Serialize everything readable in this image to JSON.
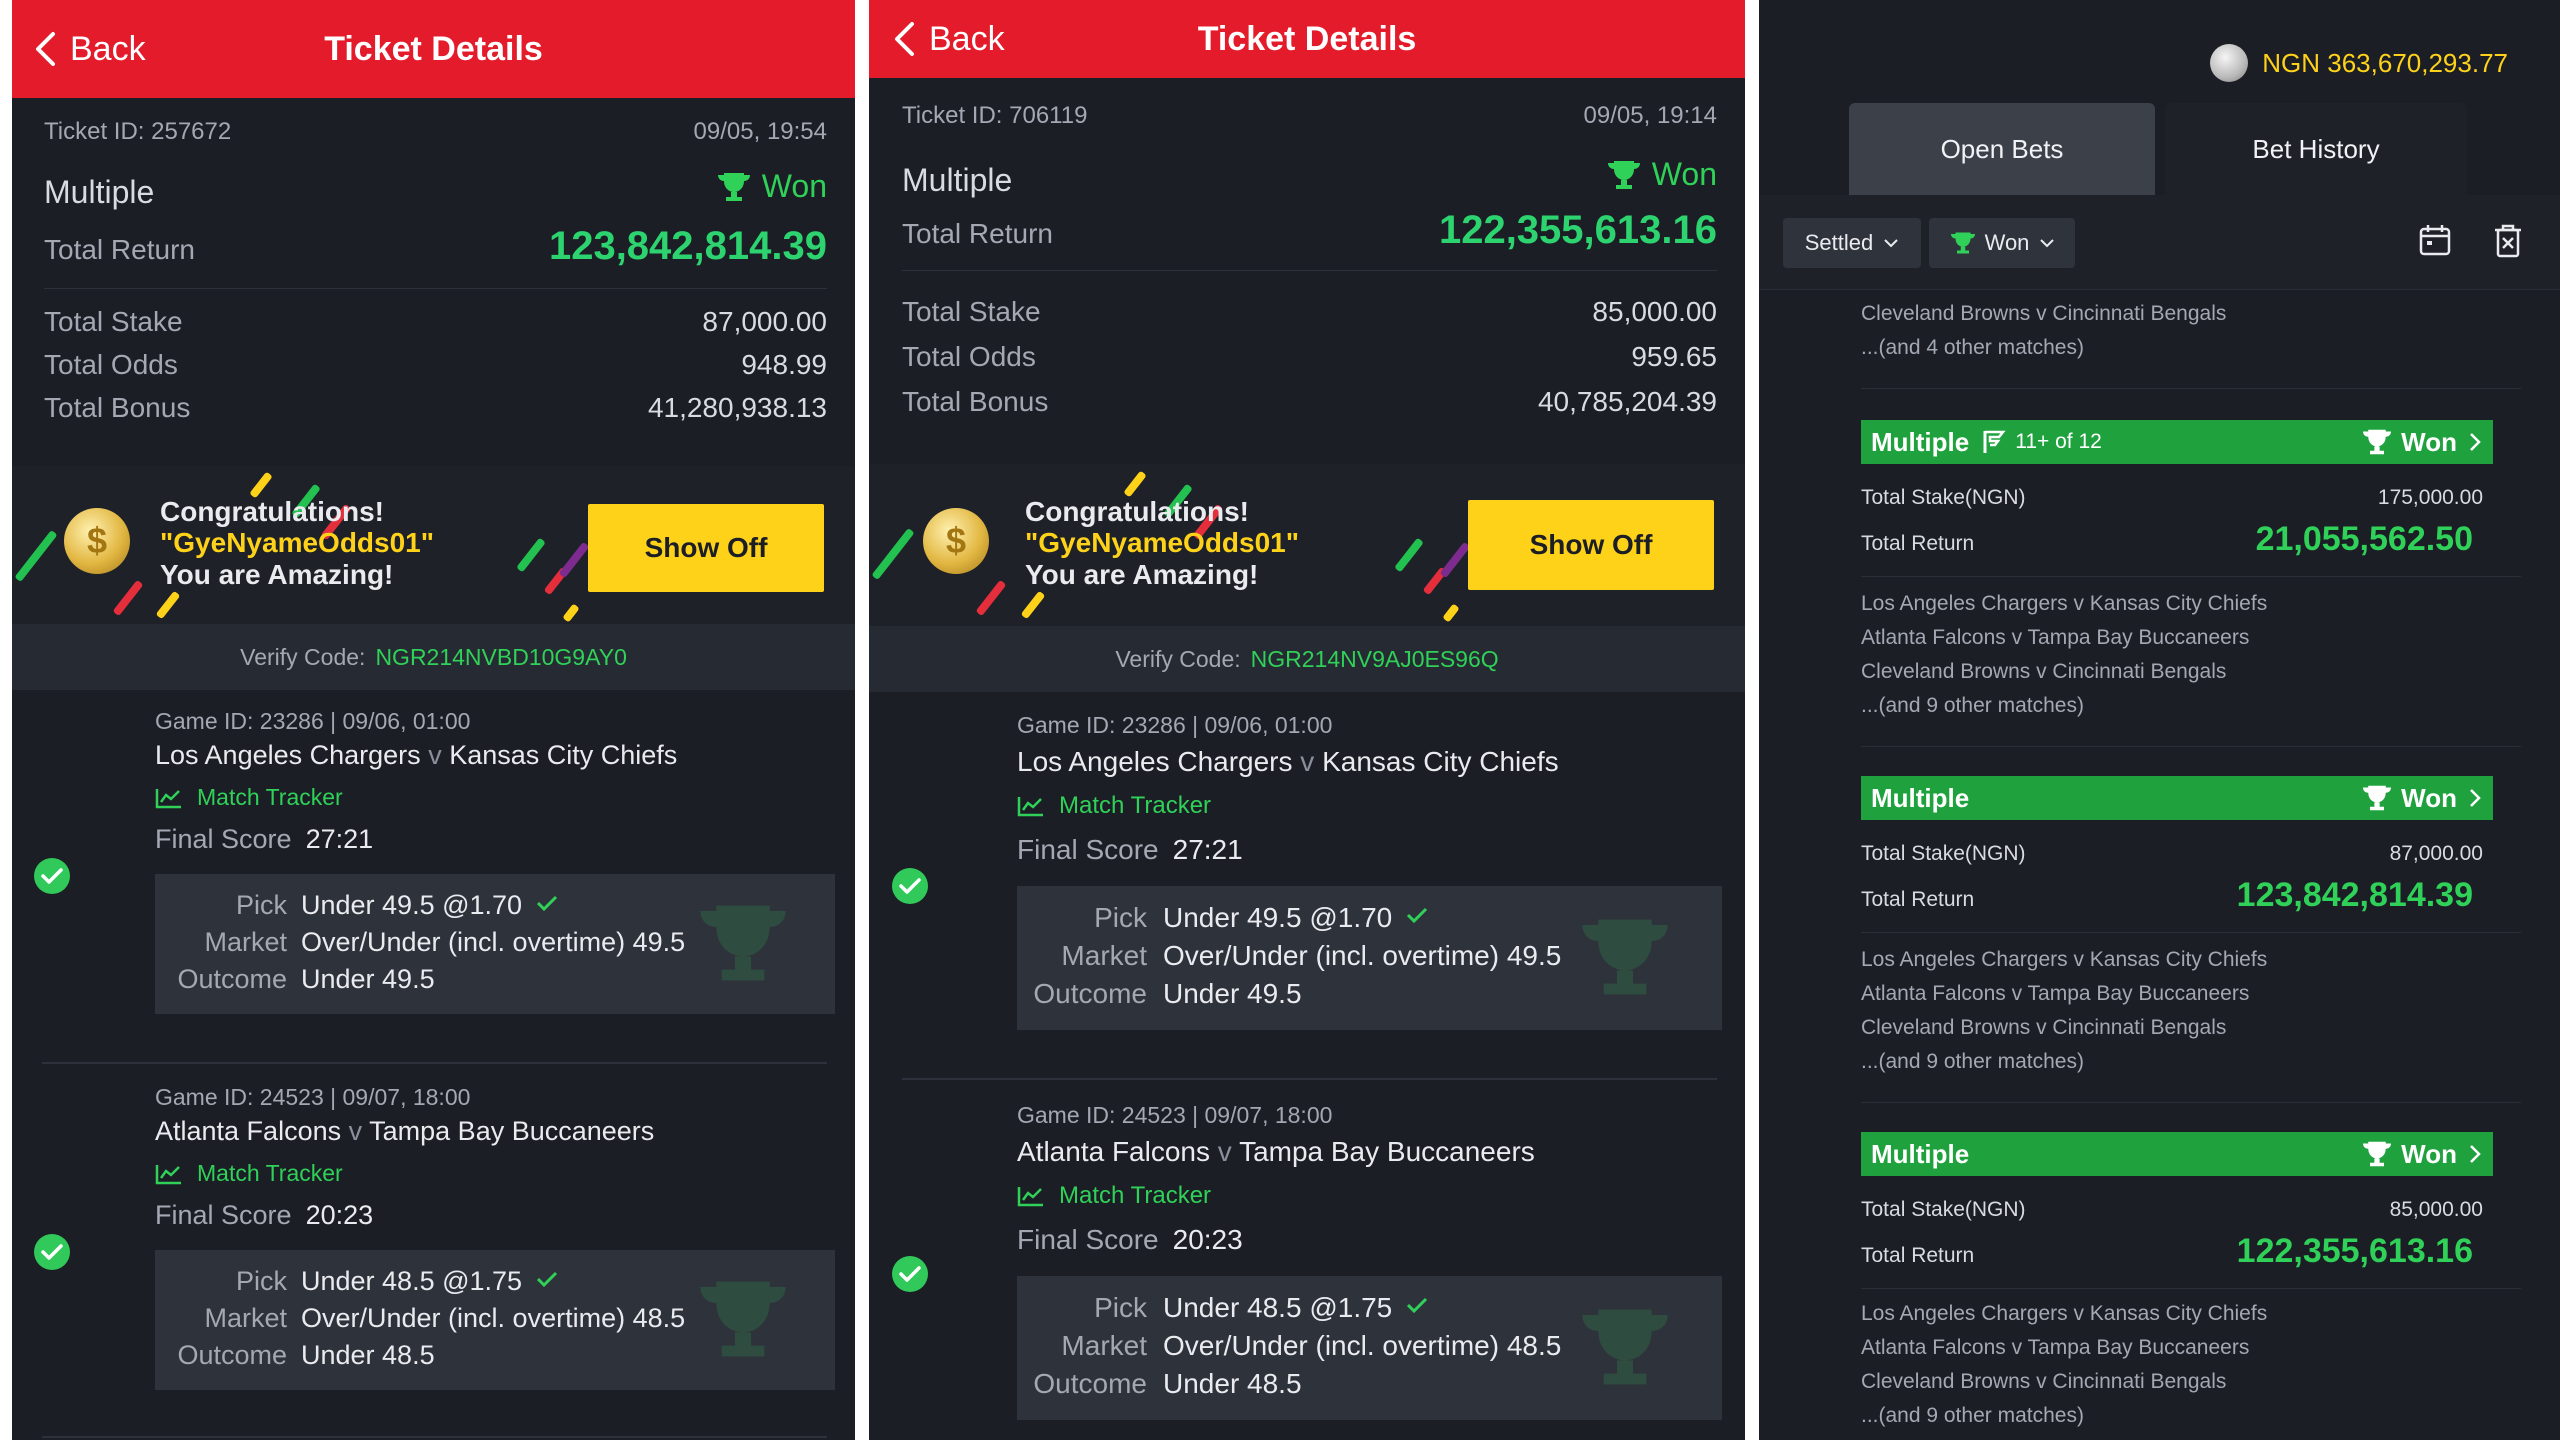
{
  "colors": {
    "header_red": "#e41b2b",
    "won_green": "#30d158",
    "bet_header_green": "#1fa23e",
    "gold": "#ffd21a",
    "background": "#1b1e25"
  },
  "tickets": [
    {
      "header": {
        "back_label": "Back",
        "title": "Ticket Details"
      },
      "ticket_id": "Ticket ID: 257672",
      "datetime": "09/05, 19:54",
      "bet_type": "Multiple",
      "status": "Won",
      "total_return_label": "Total Return",
      "total_return": "123,842,814.39",
      "total_stake_label": "Total Stake",
      "total_stake": "87,000.00",
      "total_odds_label": "Total Odds",
      "total_odds": "948.99",
      "total_bonus_label": "Total Bonus",
      "total_bonus": "41,280,938.13",
      "congrats_line1": "Congratulations!",
      "congrats_user": "\"GyeNyameOdds01\"",
      "congrats_line3": "You are Amazing!",
      "show_off_label": "Show Off",
      "verify_label": "Verify Code:",
      "verify_code": "NGR214NVBD10G9AY0",
      "games": [
        {
          "game_id": "Game ID: 23286 | 09/06, 01:00",
          "home": "Los Angeles Chargers",
          "v": "v",
          "away": "Kansas City Chiefs",
          "tracker": "Match Tracker",
          "final_label": "Final Score",
          "final_score": "27:21",
          "pick_label": "Pick",
          "pick": "Under 49.5 @1.70",
          "market_label": "Market",
          "market": "Over/Under (incl. overtime) 49.5",
          "outcome_label": "Outcome",
          "outcome": "Under 49.5"
        },
        {
          "game_id": "Game ID: 24523 | 09/07, 18:00",
          "home": "Atlanta Falcons",
          "v": "v",
          "away": "Tampa Bay Buccaneers",
          "tracker": "Match Tracker",
          "final_label": "Final Score",
          "final_score": "20:23",
          "pick_label": "Pick",
          "pick": "Under 48.5 @1.75",
          "market_label": "Market",
          "market": "Over/Under (incl. overtime) 48.5",
          "outcome_label": "Outcome",
          "outcome": "Under 48.5"
        }
      ]
    },
    {
      "header": {
        "back_label": "Back",
        "title": "Ticket Details"
      },
      "ticket_id": "Ticket ID: 706119",
      "datetime": "09/05, 19:14",
      "bet_type": "Multiple",
      "status": "Won",
      "total_return_label": "Total Return",
      "total_return": "122,355,613.16",
      "total_stake_label": "Total Stake",
      "total_stake": "85,000.00",
      "total_odds_label": "Total Odds",
      "total_odds": "959.65",
      "total_bonus_label": "Total Bonus",
      "total_bonus": "40,785,204.39",
      "congrats_line1": "Congratulations!",
      "congrats_user": "\"GyeNyameOdds01\"",
      "congrats_line3": "You are Amazing!",
      "show_off_label": "Show Off",
      "verify_label": "Verify Code:",
      "verify_code": "NGR214NV9AJ0ES96Q",
      "games": [
        {
          "game_id": "Game ID: 23286 | 09/06, 01:00",
          "home": "Los Angeles Chargers",
          "v": "v",
          "away": "Kansas City Chiefs",
          "tracker": "Match Tracker",
          "final_label": "Final Score",
          "final_score": "27:21",
          "pick_label": "Pick",
          "pick": "Under 49.5 @1.70",
          "market_label": "Market",
          "market": "Over/Under (incl. overtime) 49.5",
          "outcome_label": "Outcome",
          "outcome": "Under 49.5"
        },
        {
          "game_id": "Game ID: 24523 | 09/07, 18:00",
          "home": "Atlanta Falcons",
          "v": "v",
          "away": "Tampa Bay Buccaneers",
          "tracker": "Match Tracker",
          "final_label": "Final Score",
          "final_score": "20:23",
          "pick_label": "Pick",
          "pick": "Under 48.5 @1.75",
          "market_label": "Market",
          "market": "Over/Under (incl. overtime) 48.5",
          "outcome_label": "Outcome",
          "outcome": "Under 48.5"
        }
      ]
    }
  ],
  "history": {
    "balance": "NGN 363,670,293.77",
    "tabs": [
      "Open Bets",
      "Bet History"
    ],
    "filter_settled": "Settled",
    "filter_won": "Won",
    "top_partial": [
      "Cleveland Browns v Cincinnati Bengals",
      "...(and 4 other matches)"
    ],
    "bets": [
      {
        "type": "Multiple",
        "extra": "11+ of 12",
        "status": "Won",
        "stake_label": "Total Stake(NGN)",
        "stake": "175,000.00",
        "return_label": "Total Return",
        "return": "21,055,562.50",
        "matches": [
          "Los Angeles Chargers v Kansas City Chiefs",
          "Atlanta Falcons v Tampa Bay Buccaneers",
          "Cleveland Browns v Cincinnati Bengals",
          "...(and 9 other matches)"
        ]
      },
      {
        "type": "Multiple",
        "extra": "",
        "status": "Won",
        "stake_label": "Total Stake(NGN)",
        "stake": "87,000.00",
        "return_label": "Total Return",
        "return": "123,842,814.39",
        "matches": [
          "Los Angeles Chargers v Kansas City Chiefs",
          "Atlanta Falcons v Tampa Bay Buccaneers",
          "Cleveland Browns v Cincinnati Bengals",
          "...(and 9 other matches)"
        ]
      },
      {
        "type": "Multiple",
        "extra": "",
        "status": "Won",
        "stake_label": "Total Stake(NGN)",
        "stake": "85,000.00",
        "return_label": "Total Return",
        "return": "122,355,613.16",
        "matches": [
          "Los Angeles Chargers v Kansas City Chiefs",
          "Atlanta Falcons v Tampa Bay Buccaneers",
          "Cleveland Browns v Cincinnati Bengals",
          "...(and 9 other matches)"
        ]
      }
    ]
  }
}
